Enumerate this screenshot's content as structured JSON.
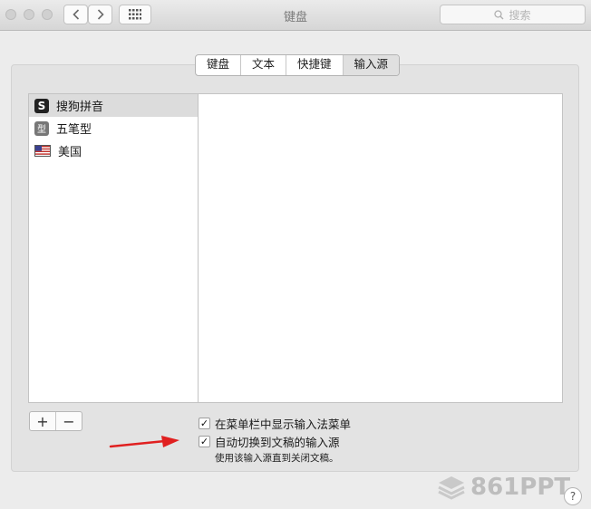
{
  "window": {
    "title": "键盘"
  },
  "toolbar": {
    "search_placeholder": "搜索"
  },
  "tabs": [
    {
      "label": "键盘"
    },
    {
      "label": "文本"
    },
    {
      "label": "快捷键"
    },
    {
      "label": "输入源",
      "selected": true
    }
  ],
  "input_sources": [
    {
      "label": "搜狗拼音",
      "icon": "sogou-icon",
      "icon_glyph": "S",
      "selected": true
    },
    {
      "label": "五笔型",
      "icon": "wubi-icon",
      "icon_glyph": "型"
    },
    {
      "label": "美国",
      "icon": "us-flag-icon"
    }
  ],
  "list_controls": {
    "add": "+",
    "remove": "−"
  },
  "options": {
    "show_menu": {
      "label": "在菜单栏中显示输入法菜单",
      "checked": true
    },
    "auto_switch": {
      "label": "自动切换到文稿的输入源",
      "checked": true
    },
    "auto_switch_hint": "使用该输入源直到关闭文稿。"
  },
  "watermark": {
    "text": "861PPT"
  },
  "help": {
    "label": "?"
  },
  "colors": {
    "annotation_arrow": "#e02020"
  }
}
